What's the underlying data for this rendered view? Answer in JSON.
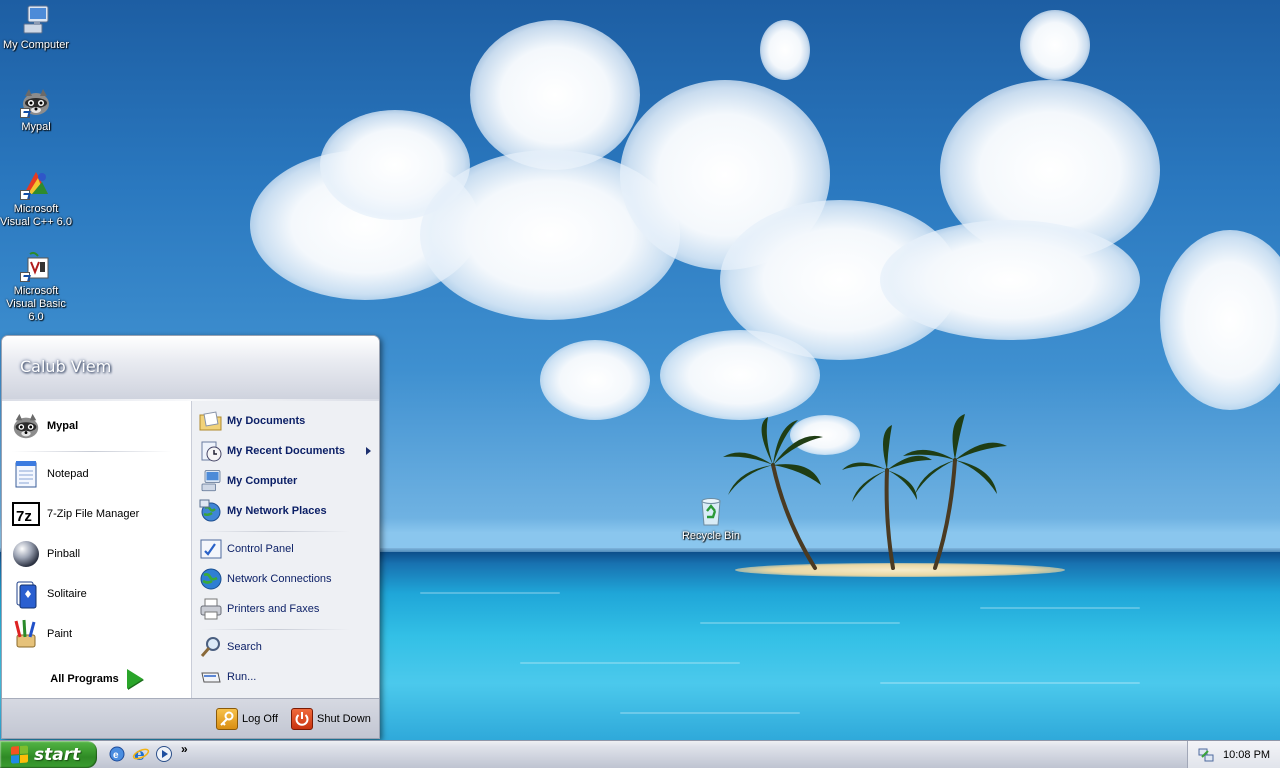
{
  "desktop": {
    "icons": [
      {
        "label": "My Computer"
      },
      {
        "label": "Mypal"
      },
      {
        "label": "Microsoft Visual C++ 6.0"
      },
      {
        "label": "Microsoft Visual Basic 6.0"
      },
      {
        "label": "Recycle Bin"
      }
    ]
  },
  "start_menu": {
    "user_name": "Calub Viem",
    "left": {
      "pinned": [
        {
          "label": "Mypal"
        }
      ],
      "recent": [
        {
          "label": "Notepad"
        },
        {
          "label": "7-Zip File Manager"
        },
        {
          "label": "Pinball"
        },
        {
          "label": "Solitaire"
        },
        {
          "label": "Paint"
        }
      ],
      "all_programs": "All Programs"
    },
    "right": {
      "items": [
        {
          "label": "My Documents"
        },
        {
          "label": "My Recent Documents"
        },
        {
          "label": "My Computer"
        },
        {
          "label": "My Network Places"
        },
        {
          "label": "Control Panel"
        },
        {
          "label": "Network Connections"
        },
        {
          "label": "Printers and Faxes"
        },
        {
          "label": "Search"
        },
        {
          "label": "Run..."
        }
      ]
    },
    "footer": {
      "log_off": "Log Off",
      "shut_down": "Shut Down"
    }
  },
  "taskbar": {
    "start_label": "start",
    "quick_launch_more": "»",
    "clock": "10:08 PM"
  },
  "colors": {
    "start_green": "#3a9a2e",
    "menu_link_blue": "#0b1f66"
  }
}
